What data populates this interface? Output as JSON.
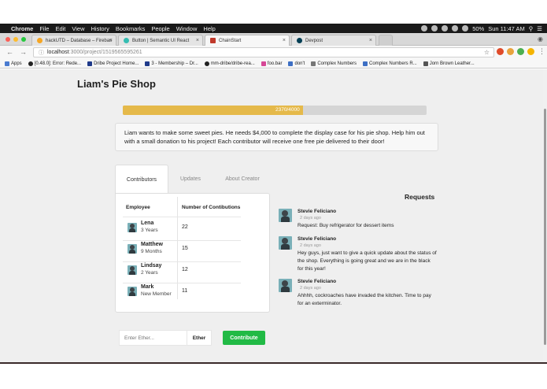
{
  "os_menu": {
    "app": "Chrome",
    "items": [
      "File",
      "Edit",
      "View",
      "History",
      "Bookmarks",
      "People",
      "Window",
      "Help"
    ],
    "battery": "50%",
    "clock": "Sun 11:47 AM"
  },
  "browser": {
    "tabs": [
      {
        "label": "hackUTD – Database – Firebas"
      },
      {
        "label": "Button | Semantic UI React"
      },
      {
        "label": "ChainStart"
      },
      {
        "label": "Devpost"
      }
    ],
    "url_host": "localhost",
    "url_rest": ":3000/project/1519565595261",
    "bookmarks": [
      "Apps",
      "[0.48.0]: Error: Rede...",
      "Dribe Project Home...",
      "3 - Membership – Dr...",
      "mm-dribe/dribe-rea...",
      "foo.bar",
      "don't",
      "Complex Numbers",
      "Complex Numbers R...",
      "Jorn Brown Leather..."
    ]
  },
  "page": {
    "title": "Liam's Pie Shop",
    "progress": {
      "label": "2370/4000",
      "raised": 2370,
      "goal": 4000
    },
    "description": "Liam wants to make some sweet pies. He needs $4,000 to complete the display case for his pie shop. Help him out with a small donation to his project! Each contributor will receive one free pie delivered to their door!",
    "tabs": [
      "Contributors",
      "Updates",
      "About Creator"
    ],
    "table": {
      "headers": [
        "Employee",
        "Number of Contibutions"
      ],
      "rows": [
        {
          "name": "Lena",
          "sub": "3 Years",
          "count": "22"
        },
        {
          "name": "Matthew",
          "sub": "9 Months",
          "count": "15"
        },
        {
          "name": "Lindsay",
          "sub": "2 Years",
          "count": "12"
        },
        {
          "name": "Mark",
          "sub": "New Member",
          "count": "11"
        }
      ]
    },
    "requests_title": "Requests",
    "requests": [
      {
        "author": "Stevie Feliciano",
        "time": "2 days ago",
        "text": "Request: Buy refrigerator for dessert items"
      },
      {
        "author": "Stevie Feliciano",
        "time": "2 days ago",
        "text": "Hey guys, just want to give a quick update about the status of the shop. Everything is going great and we are in the black for this year!"
      },
      {
        "author": "Stevie Feliciano",
        "time": "2 days ago",
        "text": "Ahhhh, cockroaches have invaded the kitchen. Time to pay for an exterminator."
      }
    ],
    "ether_placeholder": "Enter Ether...",
    "ether_label": "Ether",
    "contribute_label": "Contribute"
  },
  "colors": {
    "progress_fill": "#e5b94a",
    "contribute": "#21ba45"
  }
}
